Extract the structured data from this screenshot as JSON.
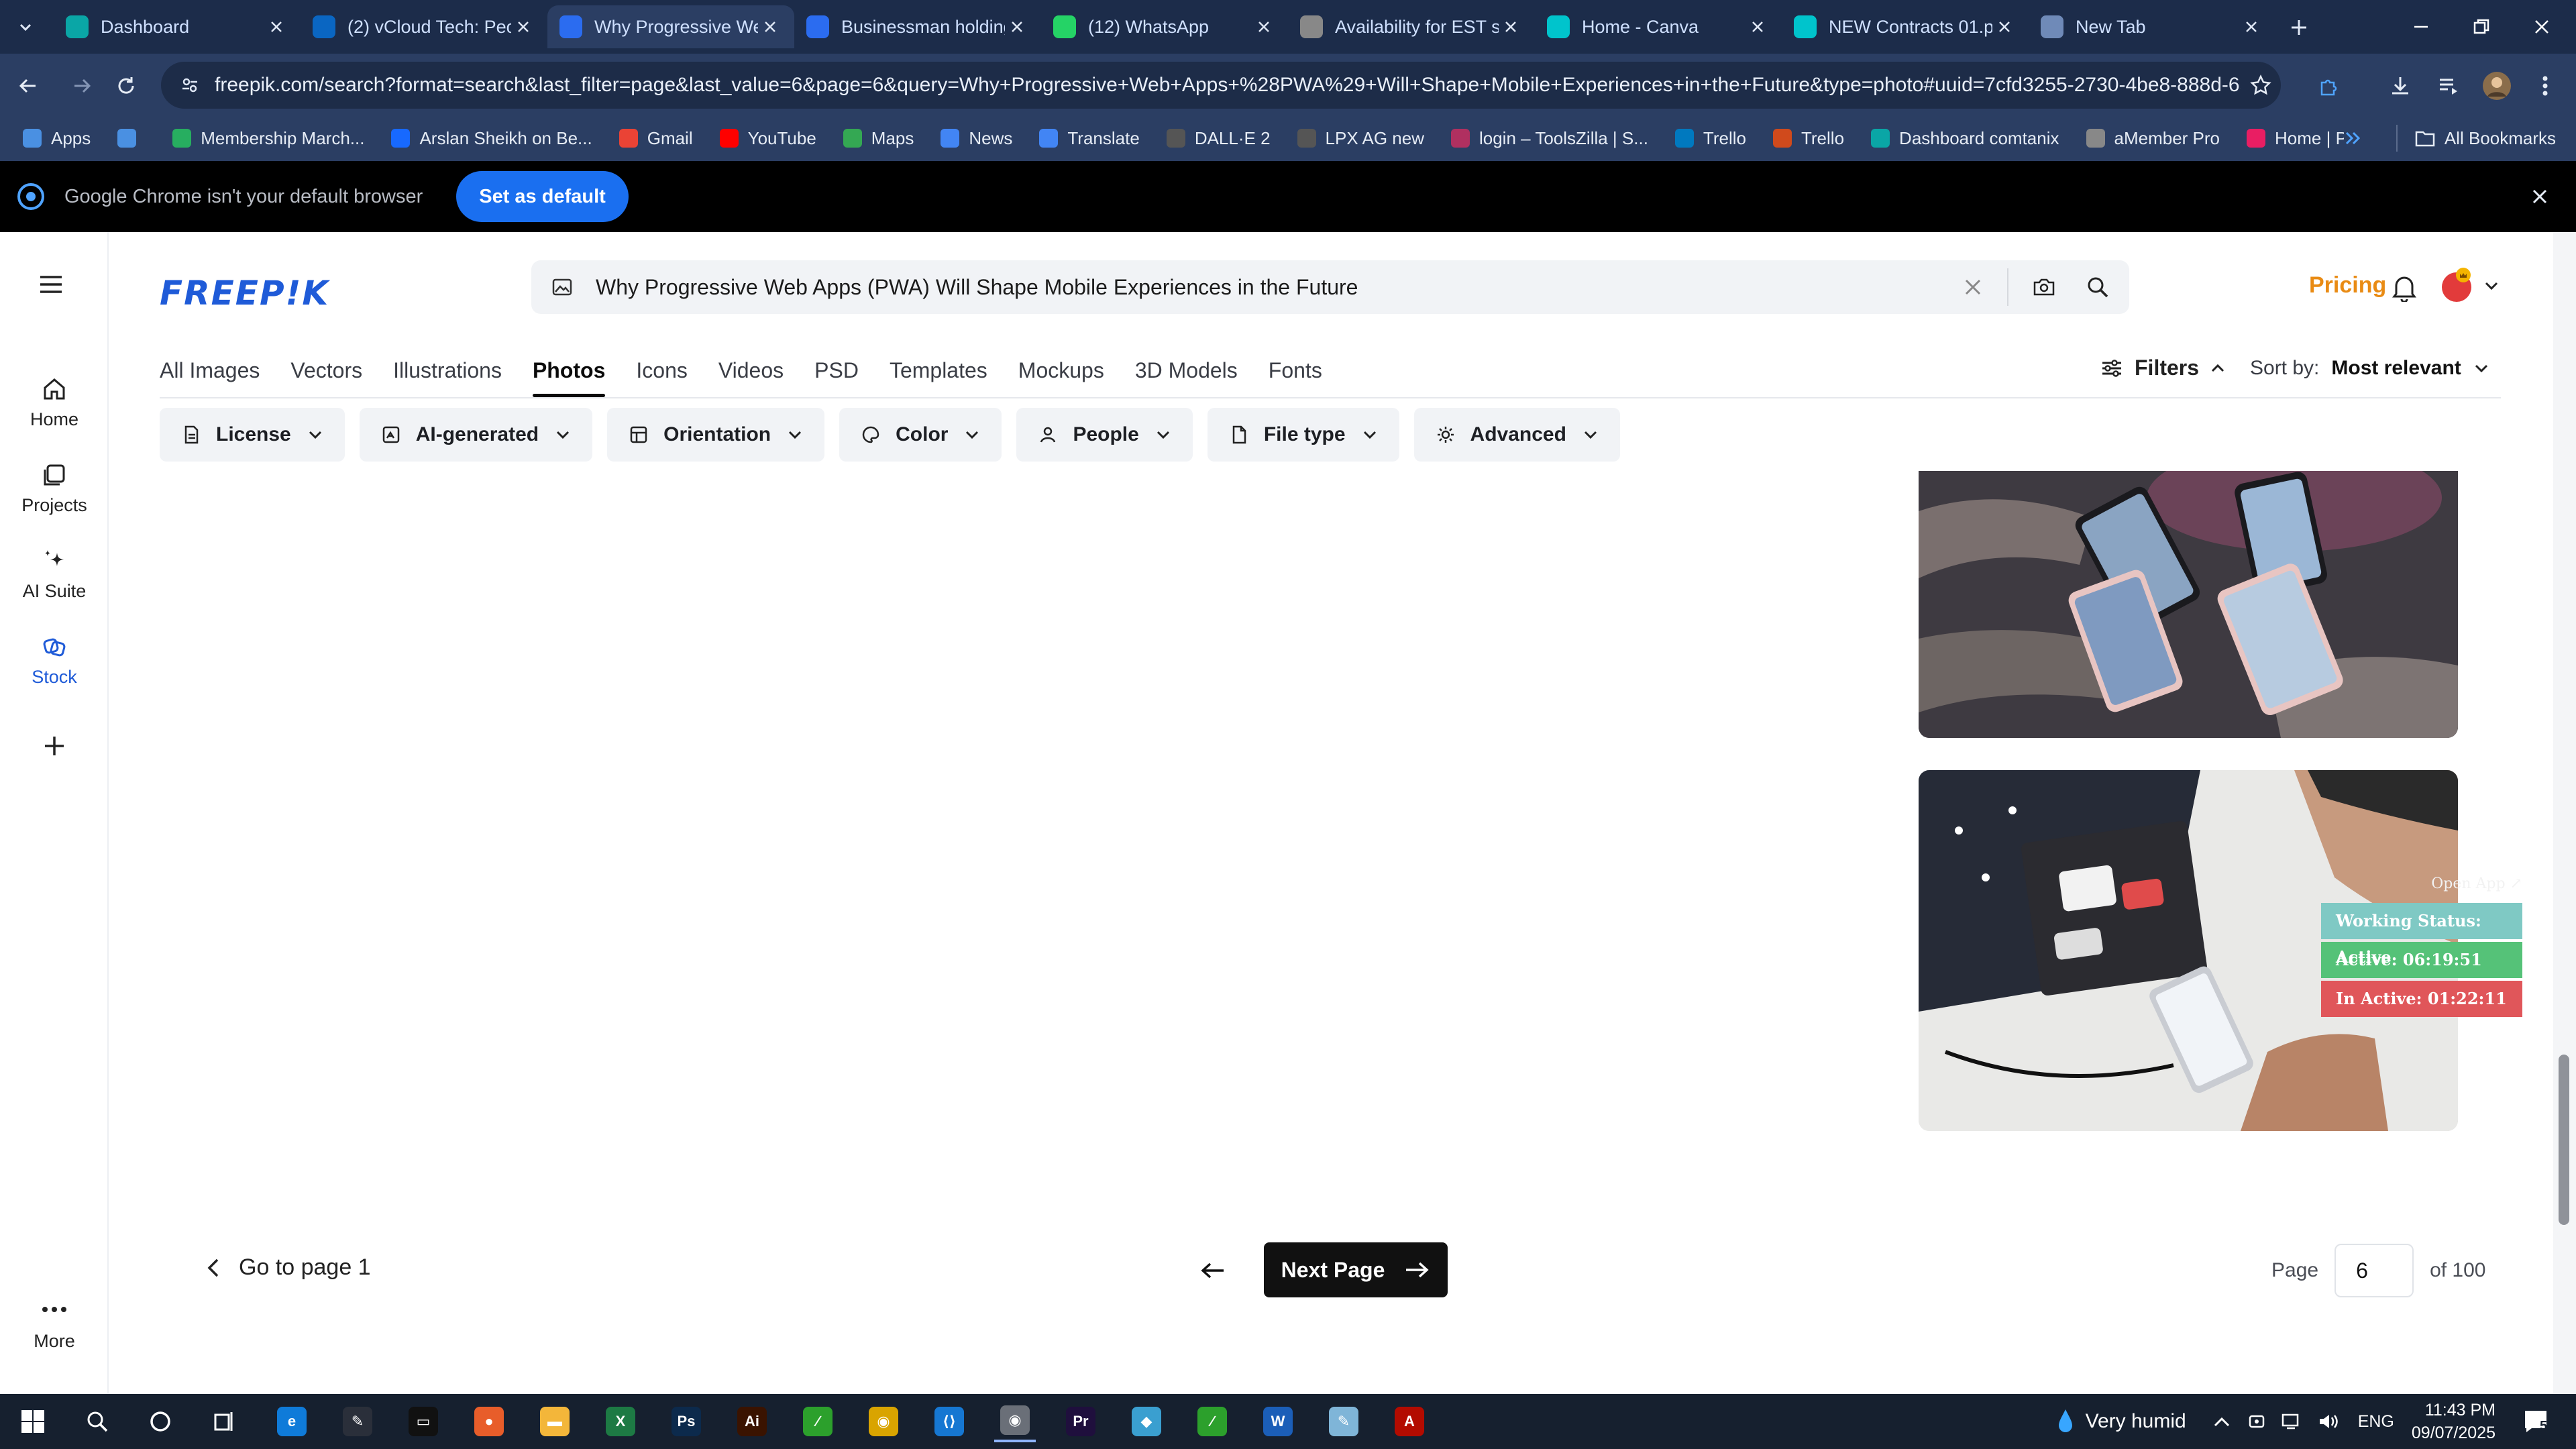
{
  "browser": {
    "tabs": [
      {
        "title": "Dashboard",
        "favicon": "#0aa6a6"
      },
      {
        "title": "(2) vCloud Tech: Peop",
        "favicon": "#0a66c2"
      },
      {
        "title": "Why Progressive Wel",
        "favicon": "#2b6cf0"
      },
      {
        "title": "Businessman holding",
        "favicon": "#2b6cf0"
      },
      {
        "title": "(12) WhatsApp",
        "favicon": "#25d366"
      },
      {
        "title": "Availability for EST sh",
        "favicon": "#888888"
      },
      {
        "title": "Home - Canva",
        "favicon": "#00c4cc"
      },
      {
        "title": "NEW Contracts 01.pd",
        "favicon": "#00c4cc"
      },
      {
        "title": "New Tab",
        "favicon": "#6f8ab8"
      }
    ],
    "active_tab_index": 2,
    "url": "freepik.com/search?format=search&last_filter=page&last_value=6&page=6&query=Why+Progressive+Web+Apps+%28PWA%29+Will+Shape+Mobile+Experiences+in+the+Future&type=photo#uuid=7cfd3255-2730-4be8-888d-657afa59190a",
    "bookmarks": [
      {
        "label": "Apps",
        "color": "#4a90e2"
      },
      {
        "label": "",
        "color": "#4a90e2"
      },
      {
        "label": "Membership March...",
        "color": "#27ae60"
      },
      {
        "label": "Arslan Sheikh on Be...",
        "color": "#1769ff"
      },
      {
        "label": "Gmail",
        "color": "#ea4335"
      },
      {
        "label": "YouTube",
        "color": "#ff0000"
      },
      {
        "label": "Maps",
        "color": "#34a853"
      },
      {
        "label": "News",
        "color": "#4285f4"
      },
      {
        "label": "Translate",
        "color": "#4285f4"
      },
      {
        "label": "DALL·E 2",
        "color": "#555555"
      },
      {
        "label": "LPX AG new",
        "color": "#555555"
      },
      {
        "label": "login – ToolsZilla | S...",
        "color": "#b03060"
      },
      {
        "label": "Trello",
        "color": "#0079bf"
      },
      {
        "label": "Trello",
        "color": "#d04a1c"
      },
      {
        "label": "Dashboard comtanix",
        "color": "#0aa6a6"
      },
      {
        "label": "aMember Pro",
        "color": "#888888"
      },
      {
        "label": "Home | PixVerse",
        "color": "#e91e63"
      }
    ],
    "all_bookmarks": "All Bookmarks",
    "infobar_message": "Google Chrome isn't your default browser",
    "infobar_button": "Set as default"
  },
  "rail": {
    "items": [
      {
        "label": "Home",
        "icon": "home-icon"
      },
      {
        "label": "Projects",
        "icon": "projects-icon"
      },
      {
        "label": "AI Suite",
        "icon": "sparkle-icon"
      },
      {
        "label": "Stock",
        "icon": "stock-icon"
      }
    ],
    "more_label": "More"
  },
  "header": {
    "logo": "FREEP!K",
    "search_query": "Why Progressive Web Apps (PWA) Will Shape Mobile Experiences in the Future",
    "pricing": "Pricing"
  },
  "categories": [
    "All Images",
    "Vectors",
    "Illustrations",
    "Photos",
    "Icons",
    "Videos",
    "PSD",
    "Templates",
    "Mockups",
    "3D Models",
    "Fonts"
  ],
  "active_category": "Photos",
  "filters_label": "Filters",
  "sort": {
    "label": "Sort by:",
    "value": "Most relevant"
  },
  "filter_chips": [
    "License",
    "AI-generated",
    "Orientation",
    "Color",
    "People",
    "File type",
    "Advanced"
  ],
  "tracker": {
    "open_app": "Open App ↗",
    "working_status": "Working Status: Active",
    "active": "Active: 06:19:51",
    "inactive": "In Active: 01:22:11",
    "colors": {
      "status": "#7fc9c4",
      "active": "#55c278",
      "inactive": "#e0565a"
    }
  },
  "pagination": {
    "go_first": "Go to page 1",
    "next": "Next Page",
    "page_label": "Page",
    "current_page": "6",
    "of_total": "of 100"
  },
  "taskbar": {
    "weather": "Very humid",
    "language": "ENG",
    "time": "11:43 PM",
    "date": "09/07/2025",
    "notification_count": "5"
  }
}
